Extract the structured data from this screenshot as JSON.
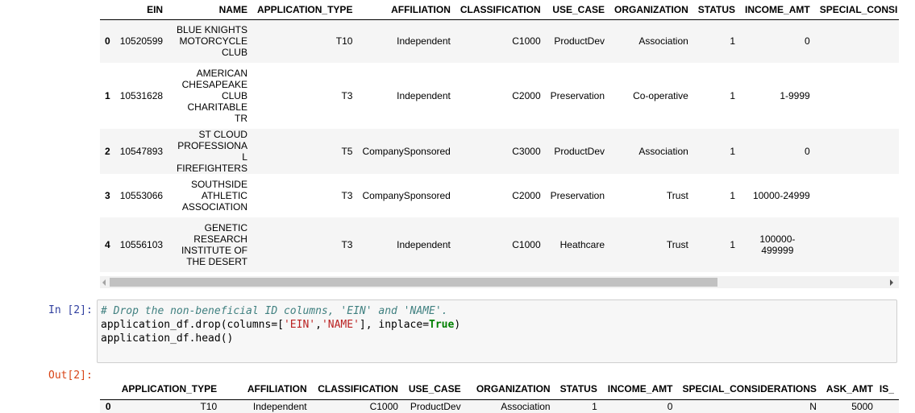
{
  "table1": {
    "columns": [
      "",
      "EIN",
      "NAME",
      "APPLICATION_TYPE",
      "AFFILIATION",
      "CLASSIFICATION",
      "USE_CASE",
      "ORGANIZATION",
      "STATUS",
      "INCOME_AMT",
      "SPECIAL_CONSI"
    ],
    "rows": [
      {
        "index": "0",
        "ein": "10520599",
        "name": "BLUE KNIGHTS MOTORCYCLE CLUB",
        "application_type": "T10",
        "affiliation": "Independent",
        "classification": "C1000",
        "use_case": "ProductDev",
        "organization": "Association",
        "status": "1",
        "income_amt": "0"
      },
      {
        "index": "1",
        "ein": "10531628",
        "name": "AMERICAN CHESAPEAKE CLUB CHARITABLE TR",
        "application_type": "T3",
        "affiliation": "Independent",
        "classification": "C2000",
        "use_case": "Preservation",
        "organization": "Co-operative",
        "status": "1",
        "income_amt": "1-9999"
      },
      {
        "index": "2",
        "ein": "10547893",
        "name": "ST CLOUD PROFESSIONAL FIREFIGHTERS",
        "application_type": "T5",
        "affiliation": "CompanySponsored",
        "classification": "C3000",
        "use_case": "ProductDev",
        "organization": "Association",
        "status": "1",
        "income_amt": "0"
      },
      {
        "index": "3",
        "ein": "10553066",
        "name": "SOUTHSIDE ATHLETIC ASSOCIATION",
        "application_type": "T3",
        "affiliation": "CompanySponsored",
        "classification": "C2000",
        "use_case": "Preservation",
        "organization": "Trust",
        "status": "1",
        "income_amt": "10000-24999"
      },
      {
        "index": "4",
        "ein": "10556103",
        "name": "GENETIC RESEARCH INSTITUTE OF THE DESERT",
        "application_type": "T3",
        "affiliation": "Independent",
        "classification": "C1000",
        "use_case": "Heathcare",
        "organization": "Trust",
        "status": "1",
        "income_amt": "100000-499999"
      }
    ]
  },
  "cell2": {
    "in_prompt": "In [2]:",
    "out_prompt": "Out[2]:",
    "code_line1_comment": "# Drop the non-beneficial ID columns, 'EIN' and 'NAME'.",
    "code_line2_a": "application_df.drop(columns=[",
    "code_line2_s1": "'EIN'",
    "code_line2_b": ",",
    "code_line2_s2": "'NAME'",
    "code_line2_c": "], inplace=",
    "code_line2_kw": "True",
    "code_line2_d": ")",
    "code_line3": "application_df.head()"
  },
  "table2": {
    "columns": [
      "",
      "APPLICATION_TYPE",
      "AFFILIATION",
      "CLASSIFICATION",
      "USE_CASE",
      "ORGANIZATION",
      "STATUS",
      "INCOME_AMT",
      "SPECIAL_CONSIDERATIONS",
      "ASK_AMT",
      "IS_"
    ],
    "row0": {
      "index": "0",
      "application_type": "T10",
      "affiliation": "Independent",
      "classification": "C1000",
      "use_case": "ProductDev",
      "organization": "Association",
      "status": "1",
      "income_amt": "0",
      "special": "N",
      "ask_amt": "5000"
    }
  },
  "scrollbar": {
    "thumb_fraction": 0.78
  }
}
